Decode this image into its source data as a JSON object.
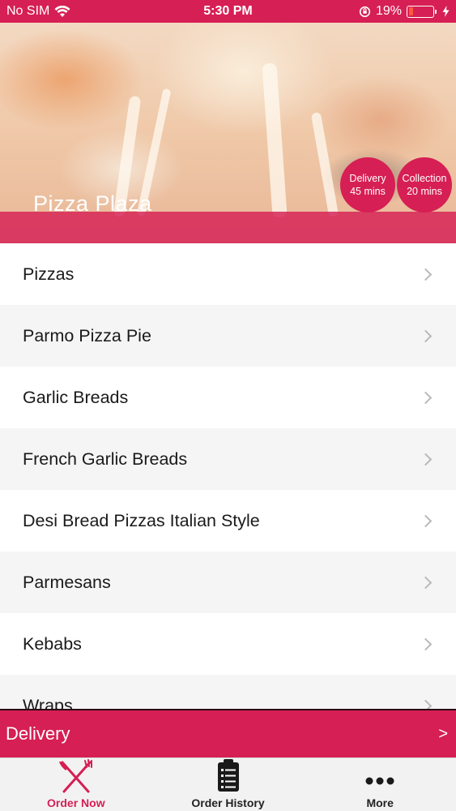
{
  "status_bar": {
    "carrier": "No SIM",
    "time": "5:30 PM",
    "battery": "19%",
    "battery_level": 0.19
  },
  "store": {
    "name": "Pizza Plaza",
    "delivery_badge": {
      "label": "Delivery",
      "time": "45 mins"
    },
    "collection_badge": {
      "label": "Collection",
      "time": "20 mins"
    }
  },
  "menu": {
    "items": [
      {
        "label": "Pizzas"
      },
      {
        "label": "Parmo Pizza Pie"
      },
      {
        "label": "Garlic Breads"
      },
      {
        "label": "French Garlic Breads"
      },
      {
        "label": "Desi Bread Pizzas Italian Style"
      },
      {
        "label": "Parmesans"
      },
      {
        "label": "Kebabs"
      },
      {
        "label": "Wraps"
      }
    ]
  },
  "order_mode": {
    "label": "Delivery",
    "arrow": ">"
  },
  "tabs": [
    {
      "label": "Order Now",
      "icon": "fork-knife-icon",
      "active": true
    },
    {
      "label": "Order History",
      "icon": "clipboard-list-icon",
      "active": false
    },
    {
      "label": "More",
      "icon": "more-dots-icon",
      "active": false
    }
  ],
  "colors": {
    "brand": "#d61f54",
    "tab_bar": "#f2f2f2"
  }
}
